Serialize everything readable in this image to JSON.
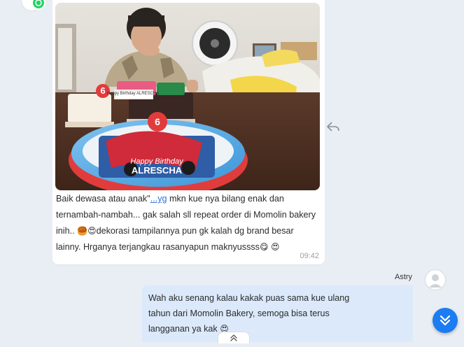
{
  "incoming_message": {
    "text_before_link": "Baik dewasa atau anak\"",
    "link_text": "...yg",
    "text_after_link": " mkn kue nya bilang enak dan ternambah-nambah... gak salah sll repeat order di Momolin bakery inih.. ",
    "emoji_1": "🥮",
    "emoji_2": "😍",
    "text_after_emoji": "dekorasi tampilannya pun gk kalah dg brand besar lainny. Hrganya terjangkau rasanyapun maknyussss",
    "emoji_3": "😋",
    "emoji_4": "😍",
    "time": "09:42",
    "photo": {
      "small_cake_topper": "Happy Birthday ALRESCHA",
      "small_candle": "6",
      "big_cake_candle": "6",
      "big_cake_label_line1": "Happy Birthday",
      "big_cake_label_line2": "ALRESCHA"
    }
  },
  "outgoing_message": {
    "sender": "Astry",
    "text": "Wah aku senang kalau kakak puas sama kue ulang tahun dari Momolin Bakery, semoga bisa terus langganan ya kak ",
    "emoji": "😍"
  },
  "icons": {
    "whatsapp_badge": "whatsapp-icon",
    "reply": "reply-icon",
    "scroll_down": "double-chevron-down-icon",
    "scroll_up": "double-chevron-up-icon",
    "avatar": "user-avatar-icon"
  },
  "colors": {
    "background": "#e9eef4",
    "incoming_bubble": "#ffffff",
    "outgoing_bubble": "#dbe9fb",
    "link": "#2f6fd6",
    "scroll_button": "#1c7cf2",
    "whatsapp": "#25d366"
  }
}
